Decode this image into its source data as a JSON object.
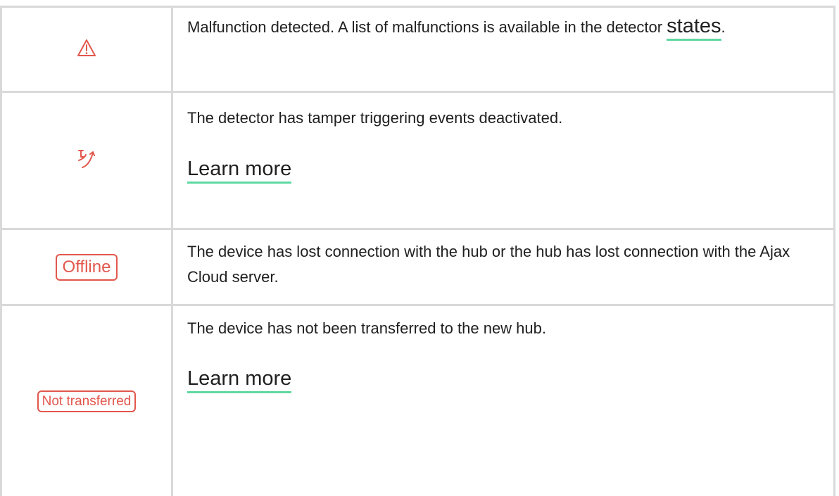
{
  "colors": {
    "accent_red": "#e2574c",
    "link_underline": "#5fd8a1",
    "border": "#d9d9d9",
    "text": "#1f1f1f"
  },
  "rows": [
    {
      "icon": "warning-triangle-icon",
      "text": "Malfunction detected. A list of malfunctions is available in the detector ",
      "link": "states",
      "suffix": "."
    },
    {
      "icon": "tamper-deactivated-icon",
      "text": "The detector has tamper triggering events deactivated.",
      "link": "Learn more"
    },
    {
      "badge": "Offline",
      "text": "The device has lost connection with the hub or the hub has lost connection with the Ajax Cloud server."
    },
    {
      "badge": "Not transferred",
      "text": "The device has not been transferred to the new hub.",
      "link": "Learn more"
    }
  ]
}
